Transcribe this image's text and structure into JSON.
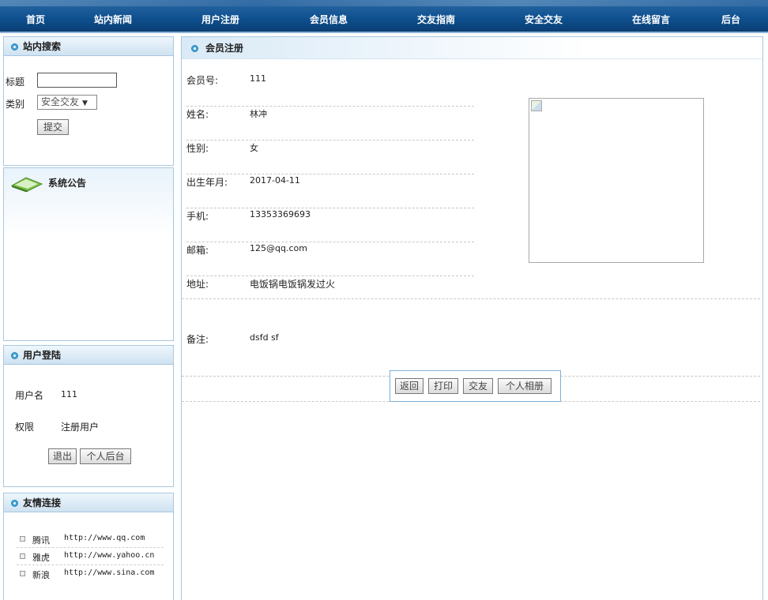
{
  "nav": {
    "items": [
      "首页",
      "站内新闻",
      "用户注册",
      "会员信息",
      "交友指南",
      "安全交友",
      "在线留言",
      "后台"
    ]
  },
  "search": {
    "title": "站内搜索",
    "title_label": "标题",
    "title_value": "",
    "category_label": "类别",
    "category_selected": "安全交友",
    "submit_label": "提交"
  },
  "notice": {
    "title": "系统公告"
  },
  "login": {
    "title": "用户登陆",
    "username_label": "用户名",
    "username_value": "111",
    "role_label": "权限",
    "role_value": "注册用户",
    "logout_label": "退出",
    "backend_label": "个人后台"
  },
  "links": {
    "title": "友情连接",
    "items": [
      {
        "name": "腾讯",
        "url": "http://www.qq.com"
      },
      {
        "name": "雅虎",
        "url": "http://www.yahoo.cn"
      },
      {
        "name": "新浪",
        "url": "http://www.sina.com"
      }
    ]
  },
  "member": {
    "title": "会员注册",
    "fields": [
      {
        "label": "会员号:",
        "value": "111"
      },
      {
        "label": "姓名:",
        "value": "林冲"
      },
      {
        "label": "性别:",
        "value": "女"
      },
      {
        "label": "出生年月:",
        "value": "2017-04-11"
      },
      {
        "label": "手机:",
        "value": "13353369693"
      },
      {
        "label": "邮箱:",
        "value": "125@qq.com"
      }
    ],
    "address_label": "地址:",
    "address_value": "电饭锅电饭锅发过火",
    "remark_label": "备注:",
    "remark_value": "dsfd sf",
    "buttons": {
      "back": "返回",
      "print": "打印",
      "friend": "交友",
      "album": "个人相册"
    }
  },
  "colors": {
    "nav_bg": "#0e4f8e",
    "panel_border": "#a9c7df",
    "panel_head_bg": "#cfe2f1"
  }
}
